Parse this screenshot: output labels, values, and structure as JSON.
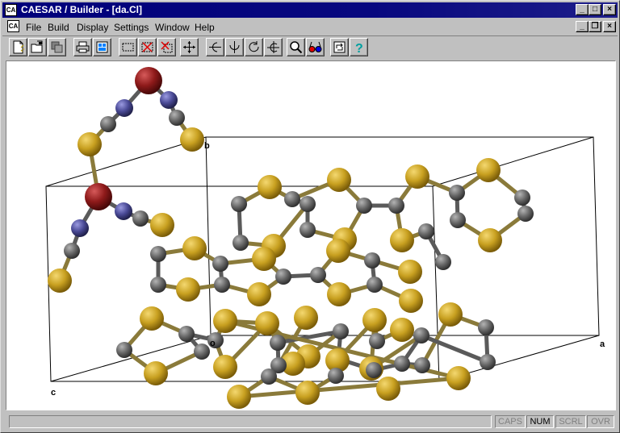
{
  "window": {
    "title": "CAESAR / Builder - [da.Cl]",
    "icon_label": "CA",
    "controls": {
      "minimize": "_",
      "maximize": "□",
      "close": "×",
      "restore": "❐"
    }
  },
  "menubar": {
    "items": [
      {
        "label": "File",
        "key": "F"
      },
      {
        "label": "Build",
        "key": "B"
      },
      {
        "label": "Display",
        "key": "D"
      },
      {
        "label": "Settings",
        "key": "S"
      },
      {
        "label": "Window",
        "key": "W"
      },
      {
        "label": "Help",
        "key": "H"
      }
    ]
  },
  "toolbar": {
    "buttons": [
      {
        "name": "new-icon"
      },
      {
        "name": "open-icon"
      },
      {
        "name": "save-icon"
      },
      {
        "name": "print-icon"
      },
      {
        "name": "print-preview-icon"
      },
      {
        "name": "select-box-icon"
      },
      {
        "name": "delete-box-icon"
      },
      {
        "name": "delete-selection-icon"
      },
      {
        "name": "translate-icon"
      },
      {
        "name": "rotate-x-icon"
      },
      {
        "name": "rotate-y-icon"
      },
      {
        "name": "rotate-z-icon"
      },
      {
        "name": "rotate-free-icon"
      },
      {
        "name": "zoom-icon"
      },
      {
        "name": "stereo-glasses-icon"
      },
      {
        "name": "refresh-icon"
      },
      {
        "name": "help-icon"
      }
    ]
  },
  "viewport": {
    "axis_labels": {
      "a": "a",
      "b": "b",
      "c": "c",
      "origin": "o"
    },
    "colors": {
      "sulfur": "#c8a020",
      "carbon": "#686868",
      "nitrogen": "#4a4a96",
      "copper": "#8e1a1a",
      "bond": "#666666",
      "cell": "#000000"
    }
  },
  "statusbar": {
    "message": "",
    "indicators": [
      {
        "label": "CAPS",
        "active": false
      },
      {
        "label": "NUM",
        "active": true
      },
      {
        "label": "SCRL",
        "active": false
      },
      {
        "label": "OVR",
        "active": false
      }
    ]
  }
}
